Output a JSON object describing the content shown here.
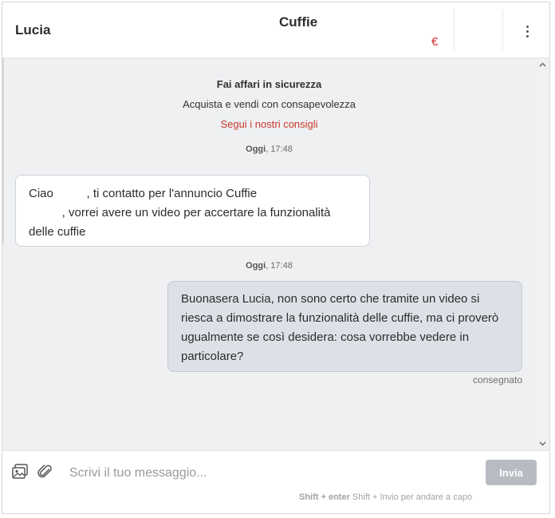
{
  "header": {
    "contact_name": "Lucia",
    "item_title": "Cuffie",
    "item_price": "€",
    "more_icon": "vertical-ellipsis-icon"
  },
  "notice": {
    "title": "Fai affari in sicurezza",
    "subtitle": "Acquista e vendi con consapevolezza",
    "link": "Segui i nostri consigli"
  },
  "messages": [
    {
      "day": "Oggi",
      "time": ", 17:48",
      "direction": "incoming",
      "lines": [
        "Ciao          , ti contatto per l'annuncio Cuffie",
        "          , vorrei avere un video per accertare la funzionalità",
        "delle cuffie"
      ]
    },
    {
      "day": "Oggi",
      "time": ", 17:48",
      "direction": "outgoing",
      "lines": [
        "Buonasera Lucia, non sono certo che tramite un video si",
        "riesca a dimostrare la funzionalità delle cuffie, ma ci proverò",
        "ugualmente se così desidera: cosa vorrebbe vedere in",
        "particolare?"
      ],
      "status": "consegnato"
    }
  ],
  "composer": {
    "image_icon": "image-attach-icon",
    "clip_icon": "paperclip-icon",
    "placeholder": "Scrivi il tuo messaggio...",
    "send_label": "Invia",
    "hint_key": "Shift + enter",
    "hint_text": " Shift + Invio per andare a capo"
  },
  "colors": {
    "accent_red": "#c9392b",
    "chat_bg": "#eff0f2",
    "outgoing_bubble": "#dde1e7",
    "send_disabled": "#b8bcc2"
  }
}
